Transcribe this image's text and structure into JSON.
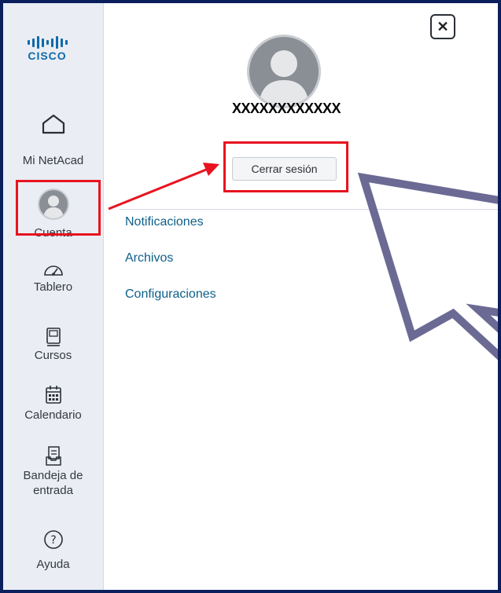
{
  "logo": {
    "text": "CISCO",
    "color": "#0d6bab"
  },
  "sidebar": {
    "items": [
      {
        "label": "Mi NetAcad",
        "icon": "home-icon"
      },
      {
        "label": "Cuenta",
        "icon": "avatar-icon",
        "active": true
      },
      {
        "label": "Tablero",
        "icon": "dashboard-icon"
      },
      {
        "label": "Cursos",
        "icon": "book-icon"
      },
      {
        "label": "Calendario",
        "icon": "calendar-icon"
      },
      {
        "label": "Bandeja de entrada",
        "icon": "inbox-icon"
      },
      {
        "label": "Ayuda",
        "icon": "help-icon"
      }
    ]
  },
  "account": {
    "username": "XXXXXXXXXXXX",
    "logout_label": "Cerrar sesión",
    "close_icon": "close-icon",
    "links": [
      "Notificaciones",
      "Archivos",
      "Configuraciones"
    ]
  },
  "colors": {
    "frame": "#0a1f5c",
    "highlight": "#e8131f",
    "link": "#0d5f8a",
    "cursor_outline": "#6b6a94"
  }
}
